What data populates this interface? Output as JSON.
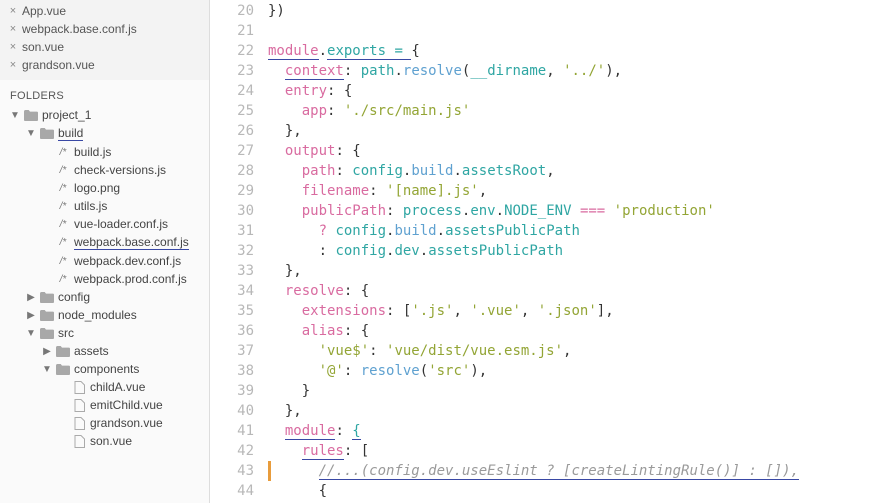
{
  "tabs": [
    {
      "label": "App.vue"
    },
    {
      "label": "webpack.base.conf.js"
    },
    {
      "label": "son.vue"
    },
    {
      "label": "grandson.vue"
    }
  ],
  "foldersLabel": "FOLDERS",
  "tree": {
    "project": "project_1",
    "build": "build",
    "buildFiles": [
      "build.js",
      "check-versions.js",
      "logo.png",
      "utils.js",
      "vue-loader.conf.js",
      "webpack.base.conf.js",
      "webpack.dev.conf.js",
      "webpack.prod.conf.js"
    ],
    "config": "config",
    "node_modules": "node_modules",
    "src": "src",
    "assets": "assets",
    "components": "components",
    "componentFiles": [
      "childA.vue",
      "emitChild.vue",
      "grandson.vue",
      "son.vue"
    ]
  },
  "code": {
    "start": 20,
    "lines": [
      {
        "n": 20,
        "seg": [
          [
            "punct",
            "})"
          ]
        ]
      },
      {
        "n": 21,
        "seg": []
      },
      {
        "n": 22,
        "seg": [
          [
            "kw-u",
            "module"
          ],
          [
            "punct",
            "."
          ],
          [
            "prop-u",
            "exports"
          ],
          [
            "prop-u",
            " = "
          ],
          [
            "punct",
            "{"
          ]
        ]
      },
      {
        "n": 23,
        "seg": [
          [
            "punct",
            "  "
          ],
          [
            "kw-u",
            "context"
          ],
          [
            "punct",
            ": "
          ],
          [
            "hl",
            "path"
          ],
          [
            "punct",
            "."
          ],
          [
            "fn",
            "resolve"
          ],
          [
            "punct",
            "("
          ],
          [
            "hl",
            "__dirname"
          ],
          [
            "punct",
            ", "
          ],
          [
            "str",
            "'../'"
          ],
          [
            "punct",
            "),"
          ]
        ]
      },
      {
        "n": 24,
        "seg": [
          [
            "punct",
            "  "
          ],
          [
            "kw",
            "entry"
          ],
          [
            "punct",
            ": {"
          ]
        ]
      },
      {
        "n": 25,
        "seg": [
          [
            "punct",
            "    "
          ],
          [
            "kw",
            "app"
          ],
          [
            "punct",
            ": "
          ],
          [
            "str",
            "'./src/main.js'"
          ]
        ]
      },
      {
        "n": 26,
        "seg": [
          [
            "punct",
            "  },"
          ]
        ]
      },
      {
        "n": 27,
        "seg": [
          [
            "punct",
            "  "
          ],
          [
            "kw",
            "output"
          ],
          [
            "punct",
            ": {"
          ]
        ]
      },
      {
        "n": 28,
        "seg": [
          [
            "punct",
            "    "
          ],
          [
            "kw",
            "path"
          ],
          [
            "punct",
            ": "
          ],
          [
            "hl",
            "config"
          ],
          [
            "punct",
            "."
          ],
          [
            "fn",
            "build"
          ],
          [
            "punct",
            "."
          ],
          [
            "hl",
            "assetsRoot"
          ],
          [
            "punct",
            ","
          ]
        ]
      },
      {
        "n": 29,
        "seg": [
          [
            "punct",
            "    "
          ],
          [
            "kw",
            "filename"
          ],
          [
            "punct",
            ": "
          ],
          [
            "str",
            "'[name].js'"
          ],
          [
            "punct",
            ","
          ]
        ]
      },
      {
        "n": 30,
        "seg": [
          [
            "punct",
            "    "
          ],
          [
            "kw",
            "publicPath"
          ],
          [
            "punct",
            ": "
          ],
          [
            "hl",
            "process"
          ],
          [
            "punct",
            "."
          ],
          [
            "hl",
            "env"
          ],
          [
            "punct",
            "."
          ],
          [
            "hl",
            "NODE_ENV"
          ],
          [
            "punct",
            " "
          ],
          [
            "kw",
            "==="
          ],
          [
            "punct",
            " "
          ],
          [
            "str",
            "'production'"
          ]
        ]
      },
      {
        "n": 31,
        "seg": [
          [
            "punct",
            "      "
          ],
          [
            "kw",
            "?"
          ],
          [
            "punct",
            " "
          ],
          [
            "hl",
            "config"
          ],
          [
            "punct",
            "."
          ],
          [
            "fn",
            "build"
          ],
          [
            "punct",
            "."
          ],
          [
            "hl",
            "assetsPublicPath"
          ]
        ]
      },
      {
        "n": 32,
        "seg": [
          [
            "punct",
            "      : "
          ],
          [
            "hl",
            "config"
          ],
          [
            "punct",
            "."
          ],
          [
            "hl",
            "dev"
          ],
          [
            "punct",
            "."
          ],
          [
            "hl",
            "assetsPublicPath"
          ]
        ]
      },
      {
        "n": 33,
        "seg": [
          [
            "punct",
            "  },"
          ]
        ]
      },
      {
        "n": 34,
        "seg": [
          [
            "punct",
            "  "
          ],
          [
            "kw",
            "resolve"
          ],
          [
            "punct",
            ": {"
          ]
        ]
      },
      {
        "n": 35,
        "seg": [
          [
            "punct",
            "    "
          ],
          [
            "kw",
            "extensions"
          ],
          [
            "punct",
            ": ["
          ],
          [
            "str",
            "'.js'"
          ],
          [
            "punct",
            ", "
          ],
          [
            "str",
            "'.vue'"
          ],
          [
            "punct",
            ", "
          ],
          [
            "str",
            "'.json'"
          ],
          [
            "punct",
            "],"
          ]
        ]
      },
      {
        "n": 36,
        "seg": [
          [
            "punct",
            "    "
          ],
          [
            "kw",
            "alias"
          ],
          [
            "punct",
            ": {"
          ]
        ]
      },
      {
        "n": 37,
        "seg": [
          [
            "punct",
            "      "
          ],
          [
            "str",
            "'vue$'"
          ],
          [
            "punct",
            ": "
          ],
          [
            "str",
            "'vue/dist/vue.esm.js'"
          ],
          [
            "punct",
            ","
          ]
        ]
      },
      {
        "n": 38,
        "seg": [
          [
            "punct",
            "      "
          ],
          [
            "str",
            "'@'"
          ],
          [
            "punct",
            ": "
          ],
          [
            "fn",
            "resolve"
          ],
          [
            "punct",
            "("
          ],
          [
            "str",
            "'src'"
          ],
          [
            "punct",
            "),"
          ]
        ]
      },
      {
        "n": 39,
        "seg": [
          [
            "punct",
            "    }"
          ]
        ]
      },
      {
        "n": 40,
        "seg": [
          [
            "punct",
            "  },"
          ]
        ]
      },
      {
        "n": 41,
        "seg": [
          [
            "punct",
            "  "
          ],
          [
            "kw-u",
            "module"
          ],
          [
            "punct",
            ": "
          ],
          [
            "prop-u",
            "{"
          ]
        ]
      },
      {
        "n": 42,
        "seg": [
          [
            "punct",
            "    "
          ],
          [
            "kw-u",
            "rules"
          ],
          [
            "punct",
            ": ["
          ]
        ]
      },
      {
        "n": 43,
        "mod": true,
        "seg": [
          [
            "punct",
            "      "
          ],
          [
            "com-u",
            "//...(config.dev.useEslint ? [createLintingRule()] : []),"
          ]
        ]
      },
      {
        "n": 44,
        "seg": [
          [
            "punct",
            "      {"
          ]
        ]
      }
    ]
  }
}
